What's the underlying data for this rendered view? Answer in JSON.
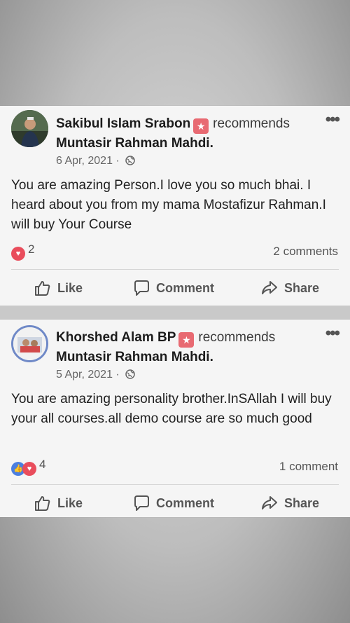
{
  "posts": [
    {
      "author": "Sakibul Islam Srabon",
      "verb": "recommends",
      "page": "Muntasir Rahman Mahdi.",
      "date": "6 Apr, 2021 ·",
      "text": "You are amazing Person.I love you so much bhai. I heard about you from my mama Mostafizur Rahman.I will buy Your Course",
      "reaction_count": "2",
      "comments": "2 comments"
    },
    {
      "author": "Khorshed Alam BP",
      "verb": "recommends",
      "page": "Muntasir Rahman Mahdi.",
      "date": "5 Apr, 2021 ·",
      "text": "You are amazing personality brother.InSAllah I will buy your all courses.all demo course are so much good",
      "reaction_count": "4",
      "comments": "1 comment"
    }
  ],
  "actions": {
    "like": "Like",
    "comment": "Comment",
    "share": "Share"
  },
  "icons": {
    "more": "more-options-icon",
    "globe": "globe-icon",
    "like": "thumbs-up-icon",
    "comment": "comment-bubble-icon",
    "share": "share-arrow-icon",
    "badge": "recommendation-star-badge-icon"
  },
  "colors": {
    "badge": "#e86a72",
    "love": "#e94d5c",
    "like": "#4b7fe0"
  }
}
